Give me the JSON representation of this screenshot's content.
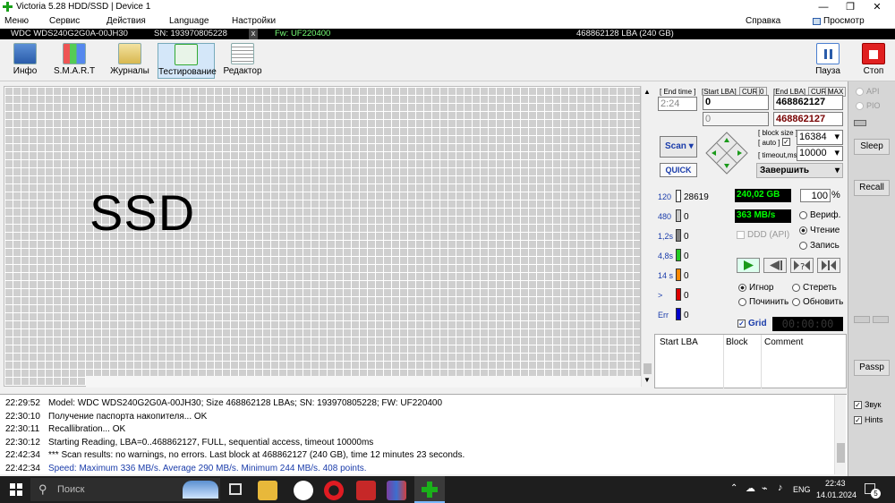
{
  "window": {
    "title": "Victoria 5.28 HDD/SSD | Device 1",
    "minimize": "—",
    "restore": "❐",
    "close": "✕"
  },
  "menu": {
    "items": [
      "Меню",
      "Сервис",
      "Действия",
      "Language",
      "Настройки"
    ],
    "help": "Справка",
    "viewer": "Просмотр буфера"
  },
  "device": {
    "model": "WDC WDS240G2G0A-00JH30",
    "sn": "SN: 193970805228",
    "close": "x",
    "fw": "Fw: UF220400",
    "lba": "468862128 LBA (240 GB)"
  },
  "toolbar": {
    "info": "Инфо",
    "smart": "S.M.A.R.T",
    "logs": "Журналы",
    "test": "Тестирование",
    "editor": "Редактор",
    "pause": "Пауза",
    "stop": "Стоп"
  },
  "surface": {
    "overlay": "SSD"
  },
  "panel": {
    "end_time_label": "[ End time ]",
    "end_time": "2:24",
    "start_lba_label": "[Start LBA]",
    "cur": "CUR",
    "zero": "0",
    "start_lba": "0",
    "start_lba2": "0",
    "end_lba_label": "[End LBA]",
    "max": "MAX",
    "end_lba": "468862127",
    "end_lba2": "468862127",
    "scan": "Scan",
    "quick": "QUICK",
    "block_size_label": "[ block size ]",
    "auto_label": "[ auto ]",
    "block_size": "16384",
    "timeout_label": "[ timeout,ms ]",
    "timeout": "10000",
    "finish": "Завершить",
    "counters": [
      {
        "label": "120",
        "value": "28619",
        "color": "#ffffff"
      },
      {
        "label": "480",
        "value": "0",
        "color": "#c8c8c8"
      },
      {
        "label": "1,2s",
        "value": "0",
        "color": "#808080"
      },
      {
        "label": "4,8s",
        "value": "0",
        "color": "#22cc22"
      },
      {
        "label": "14 s",
        "value": "0",
        "color": "#ff8800"
      },
      {
        "label": ">",
        "value": "0",
        "color": "#dd0000"
      },
      {
        "label": "Err",
        "value": "0",
        "color": "#0000cc"
      }
    ],
    "size_done": "240,02 GB",
    "percent": "100",
    "pct": "%",
    "speed": "363 MB/s",
    "verify": "Вериф.",
    "read": "Чтение",
    "write": "Запись",
    "ddd": "DDD (API)",
    "ignore": "Игнор",
    "erase": "Стереть",
    "repair": "Починить",
    "refresh": "Обновить",
    "grid": "Grid",
    "timer": "00:00:00",
    "table_headers": [
      "Start LBA",
      "Block",
      "Comment"
    ]
  },
  "side": {
    "api": "API",
    "pio": "PIO",
    "sleep": "Sleep",
    "recall": "Recall",
    "passp": "Passp",
    "sound": "Звук",
    "hints": "Hints"
  },
  "log": [
    {
      "time": "22:29:52",
      "text": "Model: WDC WDS240G2G0A-00JH30; Size 468862128 LBAs; SN: 193970805228; FW: UF220400",
      "color": "#000"
    },
    {
      "time": "22:30:10",
      "text": "Получение паспорта накопителя... OK",
      "color": "#000"
    },
    {
      "time": "22:30:11",
      "text": "Recallibration... OK",
      "color": "#000"
    },
    {
      "time": "22:30:12",
      "text": "Starting Reading, LBA=0..468862127, FULL, sequential access, timeout 10000ms",
      "color": "#000"
    },
    {
      "time": "22:42:34",
      "text": "*** Scan results: no warnings, no errors. Last block at 468862127 (240 GB), time 12 minutes 23 seconds.",
      "color": "#000"
    },
    {
      "time": "22:42:34",
      "text": "Speed: Maximum 336 MB/s. Average 290 MB/s. Minimum 244 MB/s. 408 points.",
      "color": "#1a3caa"
    }
  ],
  "taskbar": {
    "search": "Поиск",
    "lang": "ENG",
    "time": "22:43",
    "date": "14.01.2024",
    "notif": "5"
  }
}
